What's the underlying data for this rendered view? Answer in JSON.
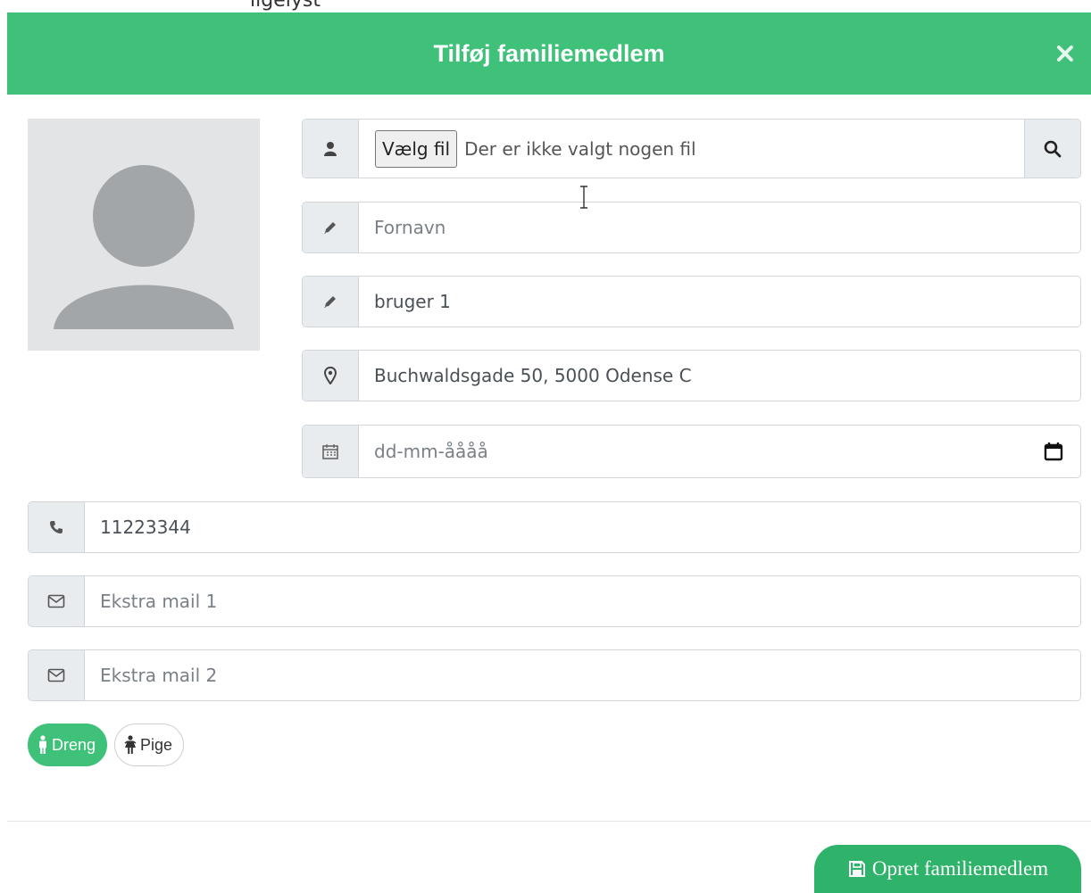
{
  "header": {
    "clipped_text": "ligelyst",
    "title": "Tilføj familiemedlem",
    "close_icon": "close-icon"
  },
  "colors": {
    "brand_green": "#3fc17a",
    "submit_green": "#2fb36a",
    "addon_bg": "#e9ecef",
    "avatar_bg": "#e2e4e6"
  },
  "form": {
    "file": {
      "button_label": "Vælg fil",
      "status": "Der er ikke valgt nogen fil"
    },
    "first_name": {
      "placeholder": "Fornavn",
      "value": ""
    },
    "last_name": {
      "value": "bruger 1"
    },
    "address": {
      "value": "Buchwaldsgade 50, 5000 Odense C"
    },
    "birthdate": {
      "placeholder": "dd-mm-åååå"
    },
    "phone": {
      "value": "11223344"
    },
    "extra_mail_1": {
      "placeholder": "Ekstra mail 1"
    },
    "extra_mail_2": {
      "placeholder": "Ekstra mail 2"
    }
  },
  "gender": {
    "options": [
      {
        "label": "Dreng",
        "selected": true
      },
      {
        "label": "Pige",
        "selected": false
      }
    ]
  },
  "footer": {
    "submit_label": "Opret familiemedlem"
  }
}
